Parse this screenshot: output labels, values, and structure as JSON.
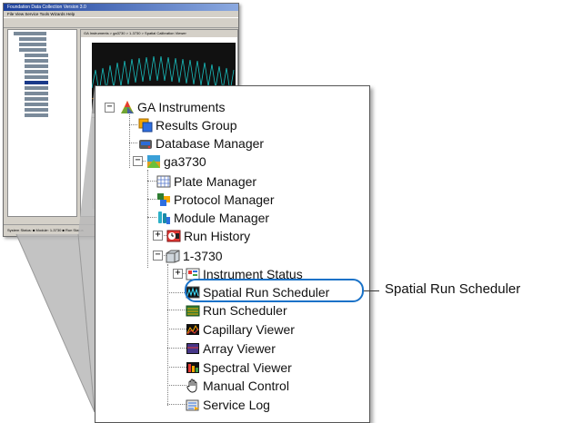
{
  "mini_window": {
    "title": "Foundation Data Collection Version 3.0",
    "menu": "File  View  Service  Tools  Wizards  Help",
    "right_header": "GA Instruments > ga3730 > 1-3730 > Spatial Calibration Viewer",
    "status": "System Status: ■   Module: 1-3730   ■   Run Status"
  },
  "tree": {
    "root": "GA Instruments",
    "results_group": "Results Group",
    "database_manager": "Database Manager",
    "instrument": "ga3730",
    "plate_manager": "Plate Manager",
    "protocol_manager": "Protocol Manager",
    "module_manager": "Module Manager",
    "run_history": "Run History",
    "module": "1-3730",
    "instrument_status": "Instrument Status",
    "spatial_run_scheduler": "Spatial Run Scheduler",
    "run_scheduler": "Run Scheduler",
    "capillary_viewer": "Capillary Viewer",
    "array_viewer": "Array Viewer",
    "spectral_viewer": "Spectral Viewer",
    "manual_control": "Manual Control",
    "service_log": "Service Log"
  },
  "toggles": {
    "minus": "−",
    "plus": "+"
  },
  "callout": {
    "label": "Spatial Run Scheduler",
    "color": "#1a72c8"
  }
}
